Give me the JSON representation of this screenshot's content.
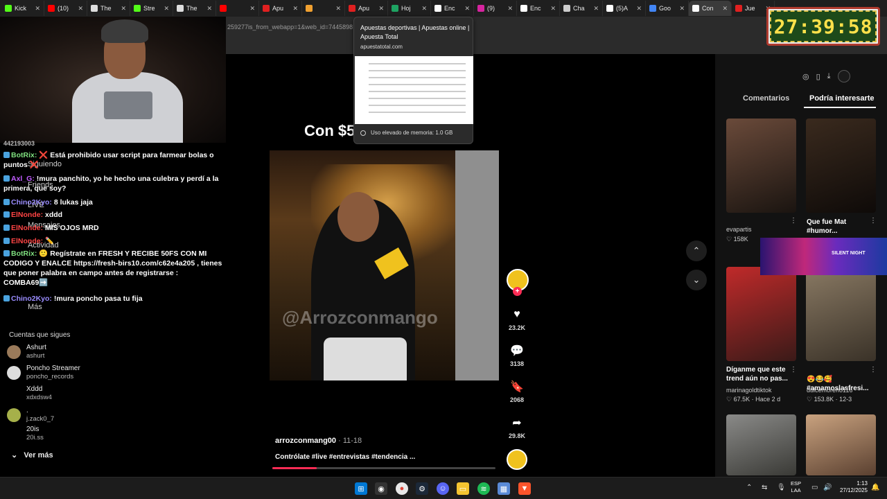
{
  "browser": {
    "tabs": [
      {
        "label": "Kick",
        "color": "#53fc18"
      },
      {
        "label": "(10)",
        "color": "#ff0000"
      },
      {
        "label": "The",
        "color": "#dddddd"
      },
      {
        "label": "Stre",
        "color": "#53fc18"
      },
      {
        "label": "The",
        "color": "#dddddd"
      },
      {
        "label": "",
        "color": "#ff0000"
      },
      {
        "label": "Apu",
        "color": "#e02020"
      },
      {
        "label": "",
        "color": "#f0a030"
      },
      {
        "label": "Apu",
        "color": "#e02020"
      },
      {
        "label": "Hoj",
        "color": "#1ea362"
      },
      {
        "label": "Enc",
        "color": "#ffffff"
      },
      {
        "label": "(9)",
        "color": "#d6249f"
      },
      {
        "label": "Enc",
        "color": "#ffffff"
      },
      {
        "label": "Cha",
        "color": "#cccccc"
      },
      {
        "label": "(5)A",
        "color": "#ffffff"
      },
      {
        "label": "Goo",
        "color": "#4285f4"
      },
      {
        "label": "Con",
        "color": "#ffffff"
      },
      {
        "label": "Jue",
        "color": "#e02020"
      }
    ],
    "address_fragment": "259277is_from_webapp=1&web_id=7445898",
    "tooltip": {
      "title": "Apuestas deportivas | Apuestas online | Apuesta Total",
      "domain": "apuestatotal.com",
      "memory": "Uso elevado de memoria: 1.0 GB"
    }
  },
  "timer": {
    "value": "27:39:58"
  },
  "chat": {
    "partial_top": "442193003",
    "messages": [
      {
        "user": "BotRix:",
        "user_color": "#7fe07f",
        "text": "❌ Está prohibido usar script para farmear bolas o puntos ❌"
      },
      {
        "user": "Axl_G:",
        "user_color": "#c05cff",
        "text": "!mura panchito, yo he hecho una culebra y perdí a la primera, que soy?"
      },
      {
        "user": "Chino2Kyo:",
        "user_color": "#9a8cff",
        "text": "8 lukas jaja"
      },
      {
        "user": "ElNonde:",
        "user_color": "#ff4444",
        "text": "xddd"
      },
      {
        "user": "ElNonde:",
        "user_color": "#ff4444",
        "text": "MIS OJOS MRD"
      },
      {
        "user": "ElNonde:",
        "user_color": "#ff4444",
        "text": "✏️"
      },
      {
        "user": "BotRix:",
        "user_color": "#7fe07f",
        "text": "🙂 Regístrate en FRESH Y RECIBE 50FS CON MI CODIGO Y ENALCE https://fresh-birs10.com/c62e4a205 , tienes que poner palabra en campo antes de registrarse : COMBA69➡️"
      },
      {
        "user": "Chino2Kyo:",
        "user_color": "#9a8cff",
        "text": "!mura poncho pasa tu fija"
      }
    ],
    "ghost_menu": [
      "Siguiendo",
      "Friends",
      "LIVE",
      "Mensajes",
      "Actividad",
      "Más"
    ]
  },
  "following": {
    "title": "Cuentas que sigues",
    "items": [
      {
        "name": "Ashurt",
        "handle": "ashurt"
      },
      {
        "name": "Poncho Streamer",
        "handle": "poncho_records"
      },
      {
        "name": "Xddd",
        "handle": "xdxdsw4"
      },
      {
        "name": ".",
        "handle": "j.zack0_7"
      },
      {
        "name": "20is",
        "handle": "20i.ss"
      }
    ],
    "more": "Ver más"
  },
  "video": {
    "title_partial": "Con $5",
    "watermark": "@Arrozconmango",
    "author": "arrozconmang00",
    "date": "· 11-18",
    "caption": "Contrólate #live #entrevistas #tendencia ...",
    "progress": 0.2,
    "stats": {
      "likes": "23.2K",
      "comments": "3138",
      "saves": "2068",
      "shares": "29.8K"
    },
    "icons": {
      "like": "heart-icon",
      "comment": "comment-icon",
      "save": "bookmark-icon",
      "share": "share-icon"
    }
  },
  "sidebar": {
    "tabs": [
      "Comentarios",
      "Podría interesarte"
    ],
    "cards": [
      {
        "title": "",
        "user": "evapartis",
        "likes": "158K",
        "extra": "",
        "c1": "#6a4a3a",
        "c2": "#1a1410"
      },
      {
        "title": "Que fue Mat #humor...",
        "user": "",
        "likes": "",
        "extra": "",
        "c1": "#3a2a1e",
        "c2": "#0e0a08"
      },
      {
        "title": "Díganme que este trend aún no pas...",
        "user": "marinagoldtiktok",
        "likes": "67.5K",
        "extra": "Hace 2 d",
        "c1": "#c02a2a",
        "c2": "#3a1a18"
      },
      {
        "title": "😍😂🥰 #amamoslasfresi...",
        "user": "dulcemoreno116",
        "likes": "153.8K",
        "extra": "12-3",
        "c1": "#8a7a64",
        "c2": "#3a3228"
      },
      {
        "title": "",
        "user": "",
        "likes": "",
        "extra": "",
        "c1": "#8a8a88",
        "c2": "#3a3a36"
      },
      {
        "title": "",
        "user": "",
        "likes": "",
        "extra": "",
        "c1": "#c9a27f",
        "c2": "#5a4030"
      }
    ],
    "banner_text": "SILENT NIGHT"
  },
  "taskbar": {
    "language": [
      "ESP",
      "LAA"
    ],
    "time": "1:13",
    "date": "27/12/2025"
  }
}
